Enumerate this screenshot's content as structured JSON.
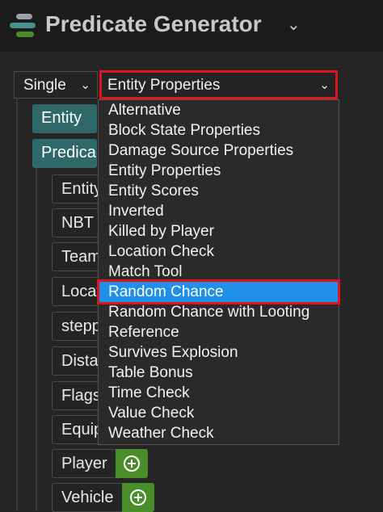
{
  "header": {
    "title": "Predicate Generator",
    "logo_colors": [
      "#9aa0a6",
      "#4a8e8e",
      "#4a8e2a"
    ]
  },
  "mode_select": {
    "value": "Single"
  },
  "type_select": {
    "value": "Entity Properties"
  },
  "tree": {
    "entity_label": "Entity",
    "predicate_label": "Predica",
    "fields": [
      {
        "label": "Entity"
      },
      {
        "label": "NBT"
      },
      {
        "label": "Team"
      },
      {
        "label": "Locat"
      },
      {
        "label": "stepp"
      },
      {
        "label": "Dista"
      },
      {
        "label": "Flags"
      },
      {
        "label": "Equip"
      },
      {
        "label": "Player"
      },
      {
        "label": "Vehicle"
      }
    ]
  },
  "dropdown": {
    "options": [
      "Alternative",
      "Block State Properties",
      "Damage Source Properties",
      "Entity Properties",
      "Entity Scores",
      "Inverted",
      "Killed by Player",
      "Location Check",
      "Match Tool",
      "Random Chance",
      "Random Chance with Looting",
      "Reference",
      "Survives Explosion",
      "Table Bonus",
      "Time Check",
      "Value Check",
      "Weather Check"
    ],
    "highlighted": "Random Chance"
  },
  "colors": {
    "teal": "#2e6868",
    "green": "#4a8e2a",
    "highlight": "#1e90e8",
    "annotation_red": "#e0141e"
  }
}
